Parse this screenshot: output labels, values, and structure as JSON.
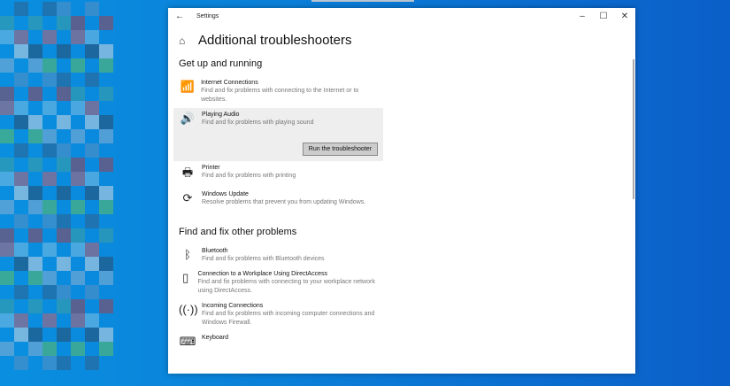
{
  "window": {
    "title": "Settings",
    "minimize": "–",
    "maximize": "☐",
    "close": "✕",
    "back": "←"
  },
  "page": {
    "title": "Additional troubleshooters"
  },
  "sections": [
    {
      "title": "Get up and running",
      "items": [
        {
          "icon": "📶",
          "name": "Internet Connections",
          "desc": "Find and fix problems with connecting to the Internet or to websites."
        },
        {
          "icon": "🔊",
          "name": "Playing Audio",
          "desc": "Find and fix problems with playing sound",
          "button": "Run the troubleshooter"
        },
        {
          "icon": "🖶",
          "name": "Printer",
          "desc": "Find and fix problems with printing"
        },
        {
          "icon": "⟳",
          "name": "Windows Update",
          "desc": "Resolve problems that prevent you from updating Windows."
        }
      ]
    },
    {
      "title": "Find and fix other problems",
      "items": [
        {
          "icon": "ᛒ",
          "name": "Bluetooth",
          "desc": "Find and fix problems with Bluetooth devices"
        },
        {
          "icon": "▯",
          "name": "Connection to a Workplace Using DirectAccess",
          "desc": "Find and fix problems with connecting to your workplace network using DirectAccess."
        },
        {
          "icon": "((·))",
          "name": "Incoming Connections",
          "desc": "Find and fix problems with incoming computer connections and Windows Firewall."
        },
        {
          "icon": "⌨",
          "name": "Keyboard",
          "desc": ""
        }
      ]
    }
  ]
}
